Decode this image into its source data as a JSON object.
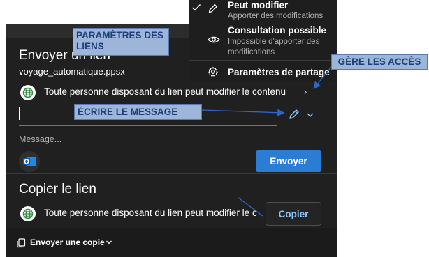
{
  "dialog": {
    "send_title": "Envoyer un lien",
    "file_name": "voyage_automatique.ppsx",
    "permission_text": "Toute personne disposant du lien peut modifier le contenu",
    "message_placeholder": "Message...",
    "send_button": "Envoyer",
    "copy_title": "Copier le lien",
    "copy_permission_text": "Toute personne disposant du lien peut modifier le c",
    "copy_button": "Copier",
    "send_copy_label": "Envoyer une copie"
  },
  "menu": {
    "items": [
      {
        "title": "Peut modifier",
        "desc": "Apporter des modifications"
      },
      {
        "title": "Consultation possible",
        "desc": "Impossible d'apporter des modifications"
      }
    ],
    "settings_label": "Paramètres de partage"
  },
  "annotations": {
    "link_settings": "PARAMÈTRES DES LIENS",
    "manage_access": "GÈRE LES ACCÈS",
    "write_message": "ÉCRIRE LE MESSAGE"
  },
  "colors": {
    "dialog_bg": "#202020",
    "accent": "#2b7cd3",
    "link_text": "#8ec4f7",
    "callout_bg": "#9cb5d8",
    "callout_text": "#1f3f7a",
    "arrow": "#2f66c8"
  },
  "icons": [
    "globe-icon",
    "chevron-right-icon",
    "pencil-icon",
    "chevron-down-icon",
    "outlook-icon",
    "checkmark-icon",
    "eye-icon",
    "gear-icon",
    "copy-icon"
  ]
}
